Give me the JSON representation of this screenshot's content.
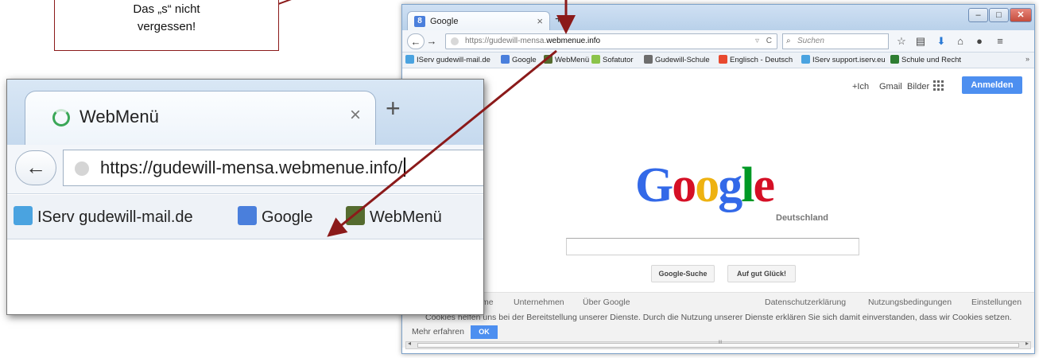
{
  "callout": {
    "line1": "Das „s“ nicht",
    "line2": "vergessen!"
  },
  "browser": {
    "tab_title": "Google",
    "tab_favicon": "8",
    "new_tab": "+",
    "window_controls": {
      "min": "–",
      "max": "□",
      "close": "✕"
    },
    "url_prefix": "https://gudewill-mensa.",
    "url_domain": "webmenue.info",
    "search_placeholder": "Suchen",
    "bookmarks": [
      {
        "label": "IServ gudewill-mail.de",
        "color": "#4aa3e0"
      },
      {
        "label": "Google",
        "color": "#4a7fdc"
      },
      {
        "label": "WebMenü",
        "color": "#556b2f"
      },
      {
        "label": "Sofatutor",
        "color": "#8bc34a"
      },
      {
        "label": "Gudewill-Schule",
        "color": "#6d6d6d"
      },
      {
        "label": "Englisch - Deutsch",
        "color": "#e8492f"
      },
      {
        "label": "IServ support.iserv.eu",
        "color": "#4aa3e0"
      },
      {
        "label": "Schule und Recht",
        "color": "#2e7d32"
      }
    ],
    "bookmarks_more": "»"
  },
  "google": {
    "top_links": [
      "+Ich",
      "Gmail",
      "Bilder"
    ],
    "signin": "Anmelden",
    "logo_letters": [
      "G",
      "o",
      "o",
      "g",
      "l",
      "e"
    ],
    "logo_colors": [
      "#3369e8",
      "#d50f25",
      "#eeb211",
      "#3369e8",
      "#009925",
      "#d50f25"
    ],
    "logo_sub": "Deutschland",
    "btn_search": "Google-Suche",
    "btn_lucky": "Auf gut Glück!",
    "footer_left": [
      "me",
      "Unternehmen",
      "Über Google"
    ],
    "footer_right": [
      "Datenschutzerklärung",
      "Nutzungsbedingungen",
      "Einstellungen"
    ],
    "cookie_text": "Cookies helfen uns bei der Bereitstellung unserer Dienste. Durch die Nutzung unserer Dienste erklären Sie sich damit einverstanden, dass wir Cookies setzen.",
    "cookie_more": "Mehr erfahren",
    "cookie_ok": "OK",
    "scroll_mark": "III"
  },
  "zoom": {
    "tab_title": "WebMenü",
    "close": "×",
    "plus": "+",
    "back": "←",
    "url": "https://gudewill-mensa.webmenue.info/",
    "bookmarks": [
      {
        "label": "IServ gudewill-mail.de",
        "color": "#4aa3e0"
      },
      {
        "label": "Google",
        "color": "#4a7fdc"
      },
      {
        "label": "WebMenü",
        "color": "#556b2f"
      }
    ]
  },
  "accent": {
    "arrow": "#8b1a1a",
    "google_blue": "#4d8ff0"
  }
}
